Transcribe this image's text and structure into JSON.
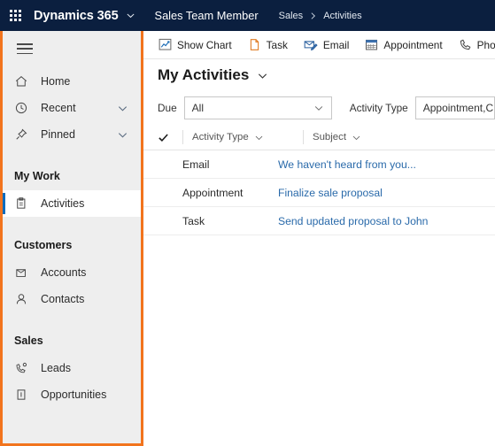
{
  "header": {
    "waffle_icon": "app-launcher-waffle-icon",
    "brand": "Dynamics 365",
    "brand_chevron_icon": "chevron-down-icon",
    "app_name": "Sales Team Member",
    "breadcrumb": {
      "parent": "Sales",
      "separator_icon": "chevron-right-icon",
      "current": "Activities"
    }
  },
  "sidebar": {
    "hamburger_icon": "hamburger-menu-icon",
    "highlight_color": "#f2741d",
    "selected_accent_color": "#0f6cbd",
    "top_items": [
      {
        "label": "Home",
        "icon": "home-icon",
        "chevron": false
      },
      {
        "label": "Recent",
        "icon": "clock-icon",
        "chevron": true
      },
      {
        "label": "Pinned",
        "icon": "pin-icon",
        "chevron": true
      }
    ],
    "groups": [
      {
        "title": "My Work",
        "items": [
          {
            "label": "Activities",
            "icon": "clipboard-icon",
            "selected": true
          }
        ]
      },
      {
        "title": "Customers",
        "items": [
          {
            "label": "Accounts",
            "icon": "building-icon",
            "selected": false
          },
          {
            "label": "Contacts",
            "icon": "person-icon",
            "selected": false
          }
        ]
      },
      {
        "title": "Sales",
        "items": [
          {
            "label": "Leads",
            "icon": "phone-lead-icon",
            "selected": false
          },
          {
            "label": "Opportunities",
            "icon": "opportunity-icon",
            "selected": false
          }
        ]
      }
    ]
  },
  "commandbar": {
    "items": [
      {
        "label": "Show Chart",
        "icon": "chart-icon"
      },
      {
        "label": "Task",
        "icon": "task-document-icon"
      },
      {
        "label": "Email",
        "icon": "email-edit-icon"
      },
      {
        "label": "Appointment",
        "icon": "calendar-icon"
      },
      {
        "label": "Phone Call",
        "icon": "phone-icon"
      }
    ]
  },
  "view": {
    "title": "My Activities",
    "chevron_icon": "chevron-down-icon"
  },
  "filters": {
    "due": {
      "label": "Due",
      "value": "All",
      "chevron_icon": "chevron-down-icon"
    },
    "activity_type": {
      "label": "Activity Type",
      "value": "Appointment,C"
    }
  },
  "grid": {
    "select_all_icon": "checkmark-icon",
    "columns": [
      {
        "label": "Activity Type",
        "chevron_icon": "chevron-down-icon"
      },
      {
        "label": "Subject",
        "chevron_icon": "chevron-down-icon"
      }
    ],
    "rows": [
      {
        "activity_type": "Email",
        "subject": "We haven't heard from you..."
      },
      {
        "activity_type": "Appointment",
        "subject": "Finalize sale proposal"
      },
      {
        "activity_type": "Task",
        "subject": "Send updated proposal to John"
      }
    ]
  }
}
